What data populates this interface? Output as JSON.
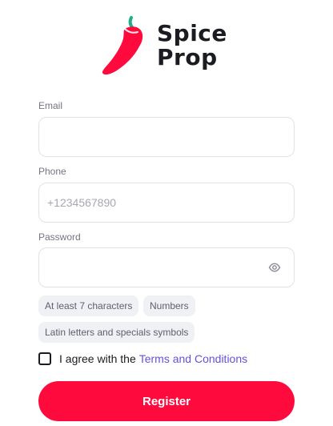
{
  "brand": {
    "line1": "Spice",
    "line2": "Prop",
    "accent": "#ff0a3c",
    "stem": "#1fae8a"
  },
  "form": {
    "email": {
      "label": "Email",
      "value": "",
      "placeholder": ""
    },
    "phone": {
      "label": "Phone",
      "value": "",
      "placeholder": "+1234567890"
    },
    "password": {
      "label": "Password",
      "value": "",
      "placeholder": "",
      "toggle_icon": "eye-icon"
    },
    "password_rules": [
      "At least 7 characters",
      "Numbers",
      "Latin letters and specials symbols"
    ],
    "agree": {
      "checked": false,
      "text": "I agree with the",
      "link_text": "Terms and Conditions"
    },
    "submit_label": "Register"
  },
  "colors": {
    "link": "#6a4fd6",
    "chip_bg": "#f0f1f5",
    "border": "#e1e2e8"
  }
}
